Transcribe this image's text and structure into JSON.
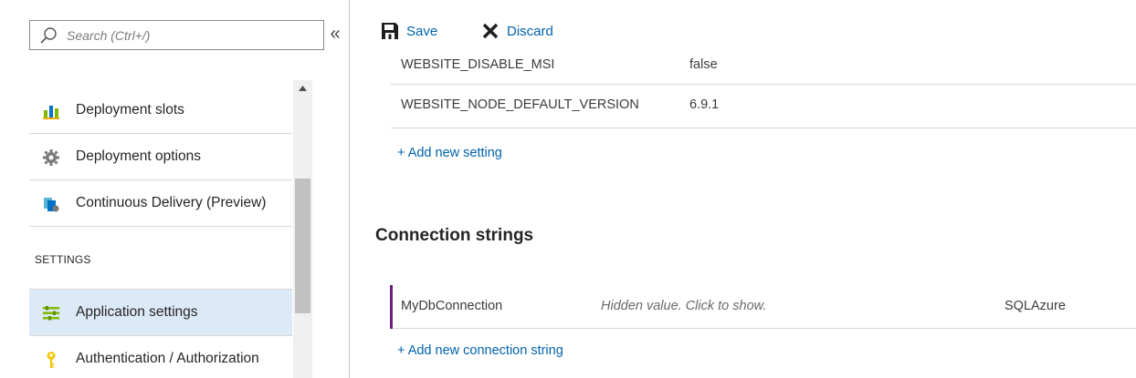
{
  "sidebar": {
    "search": {
      "placeholder": "Search (Ctrl+/)",
      "value": ""
    },
    "collapse_label": "«",
    "items_top": [
      {
        "label": "Deployment slots",
        "icon": "deployment-slots-icon"
      },
      {
        "label": "Deployment options",
        "icon": "gear-icon"
      },
      {
        "label": "Continuous Delivery (Preview)",
        "icon": "continuous-delivery-icon"
      }
    ],
    "section_label": "SETTINGS",
    "items_settings": [
      {
        "label": "Application settings",
        "icon": "app-settings-icon",
        "active": true
      },
      {
        "label": "Authentication / Authorization",
        "icon": "key-icon"
      }
    ]
  },
  "toolbar": {
    "save_label": "Save",
    "discard_label": "Discard"
  },
  "app_settings": {
    "rows": [
      {
        "key": "WEBSITE_DISABLE_MSI",
        "value": "false"
      },
      {
        "key": "WEBSITE_NODE_DEFAULT_VERSION",
        "value": "6.9.1"
      }
    ],
    "add_label": "+ Add new setting"
  },
  "connection_strings": {
    "title": "Connection strings",
    "rows": [
      {
        "name": "MyDbConnection",
        "value": "Hidden value. Click to show.",
        "type": "SQLAzure"
      }
    ],
    "add_label": "+ Add new connection string"
  },
  "colors": {
    "accent_link": "#0062ad",
    "active_item_bg": "#dce9f7",
    "connection_accent": "#68217a"
  }
}
